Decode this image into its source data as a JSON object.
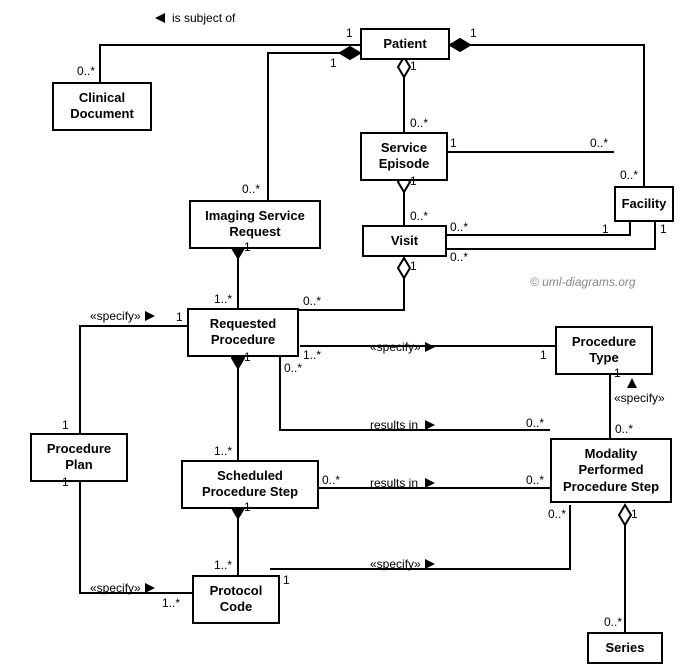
{
  "watermark": "© uml-diagrams.org",
  "classes": {
    "patient": "Patient",
    "clinical_document": "Clinical\nDocument",
    "service_episode": "Service\nEpisode",
    "facility": "Facility",
    "imaging_service_request": "Imaging Service\nRequest",
    "visit": "Visit",
    "requested_procedure": "Requested\nProcedure",
    "procedure_type": "Procedure\nType",
    "procedure_plan": "Procedure\nPlan",
    "scheduled_procedure_step": "Scheduled\nProcedure Step",
    "modality_performed_procedure_step": "Modality\nPerformed\nProcedure Step",
    "protocol_code": "Protocol\nCode",
    "series": "Series"
  },
  "relations": {
    "is_subject_of": "is subject of",
    "specify": "«specify»",
    "results_in": "results in"
  },
  "mult": {
    "one": "1",
    "zero_star": "0..*",
    "one_star": "1..*"
  },
  "chart_data": {
    "type": "table",
    "diagram_kind": "uml_class",
    "classes": [
      "Patient",
      "Clinical Document",
      "Service Episode",
      "Facility",
      "Imaging Service Request",
      "Visit",
      "Requested Procedure",
      "Procedure Type",
      "Procedure Plan",
      "Scheduled Procedure Step",
      "Modality Performed Procedure Step",
      "Protocol Code",
      "Series"
    ],
    "associations": [
      {
        "from": "Patient",
        "to": "Clinical Document",
        "kind": "association",
        "name": "is subject of",
        "navigates_to": "Patient",
        "from_mult": "1",
        "to_mult": "0..*"
      },
      {
        "from": "Patient",
        "to": "Imaging Service Request",
        "kind": "composition",
        "whole": "Patient",
        "from_mult": "1",
        "to_mult": "0..*"
      },
      {
        "from": "Patient",
        "to": "Service Episode",
        "kind": "aggregation",
        "whole": "Patient",
        "from_mult": "1",
        "to_mult": "0..*"
      },
      {
        "from": "Patient",
        "to": "Facility",
        "kind": "composition",
        "whole": "Facility",
        "from_mult": "0..*",
        "to_mult": "1"
      },
      {
        "from": "Service Episode",
        "to": "Visit",
        "kind": "aggregation",
        "whole": "Service Episode",
        "from_mult": "1",
        "to_mult": "0..*"
      },
      {
        "from": "Service Episode",
        "to": "Facility",
        "kind": "association",
        "from_mult": "1",
        "to_mult": "0..*"
      },
      {
        "from": "Visit",
        "to": "Facility",
        "kind": "association",
        "from_mult": "0..*",
        "to_mult": "1"
      },
      {
        "from": "Visit",
        "to": "Facility",
        "kind": "association",
        "from_mult": "0..*",
        "to_mult": "1"
      },
      {
        "from": "Imaging Service Request",
        "to": "Requested Procedure",
        "kind": "composition",
        "whole": "Imaging Service Request",
        "from_mult": "1",
        "to_mult": "1..*"
      },
      {
        "from": "Visit",
        "to": "Requested Procedure",
        "kind": "aggregation",
        "whole": "Visit",
        "from_mult": "1",
        "to_mult": "0..*"
      },
      {
        "from": "Procedure Plan",
        "to": "Requested Procedure",
        "kind": "association",
        "name": "«specify»",
        "from_mult": "1",
        "to_mult": "1"
      },
      {
        "from": "Requested Procedure",
        "to": "Procedure Type",
        "kind": "association",
        "name": "«specify»",
        "from_mult": "1..*",
        "to_mult": "1"
      },
      {
        "from": "Requested Procedure",
        "to": "Scheduled Procedure Step",
        "kind": "composition",
        "whole": "Requested Procedure",
        "from_mult": "1",
        "to_mult": "1..*"
      },
      {
        "from": "Requested Procedure",
        "to": "Modality Performed Procedure Step",
        "kind": "association",
        "name": "results in",
        "from_mult": "0..*",
        "to_mult": "0..*"
      },
      {
        "from": "Scheduled Procedure Step",
        "to": "Modality Performed Procedure Step",
        "kind": "association",
        "name": "results in",
        "from_mult": "0..*",
        "to_mult": "0..*"
      },
      {
        "from": "Scheduled Procedure Step",
        "to": "Protocol Code",
        "kind": "composition",
        "whole": "Scheduled Procedure Step",
        "from_mult": "1",
        "to_mult": "1..*"
      },
      {
        "from": "Procedure Plan",
        "to": "Protocol Code",
        "kind": "association",
        "name": "«specify»",
        "from_mult": "1",
        "to_mult": "1..*"
      },
      {
        "from": "Protocol Code",
        "to": "Modality Performed Procedure Step",
        "kind": "association",
        "name": "«specify»",
        "from_mult": "1",
        "to_mult": "0..*"
      },
      {
        "from": "Modality Performed Procedure Step",
        "to": "Procedure Type",
        "kind": "association",
        "name": "«specify»",
        "from_mult": "0..*",
        "to_mult": "1"
      },
      {
        "from": "Modality Performed Procedure Step",
        "to": "Series",
        "kind": "aggregation",
        "whole": "Modality Performed Procedure Step",
        "from_mult": "1",
        "to_mult": "0..*"
      }
    ]
  }
}
